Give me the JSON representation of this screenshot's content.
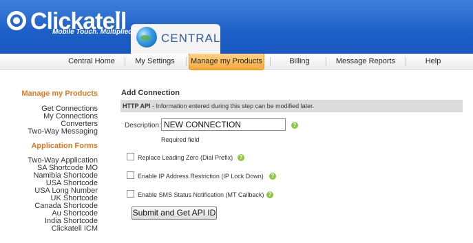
{
  "brand": {
    "logo_text": "Clickatell",
    "trademark": "™",
    "tagline": "Mobile Touch. Multiplied.",
    "central_label": "CENTRAL"
  },
  "nav": {
    "items": [
      {
        "label": "Central Home"
      },
      {
        "label": "My Settings"
      },
      {
        "label": "Manage my Products",
        "active": true
      },
      {
        "label": "Billing"
      },
      {
        "label": "Message Reports"
      },
      {
        "label": "Help"
      }
    ]
  },
  "sidebar": {
    "section1_title": "Manage my Products",
    "section1_links": [
      "Get Connections",
      "My Connections",
      "Converters",
      "Two-Way Messaging"
    ],
    "section2_title": "Application Forms",
    "section2_links": [
      "Two-Way Application",
      "SA Shortcode MO",
      "Namibia Shortcode",
      "USA Shortcode",
      "USA Long Number",
      "UK Shortcode",
      "Canada Shortcode",
      "Au Shortcode",
      "India Shortcode",
      "Clickatell ICM"
    ]
  },
  "form": {
    "title": "Add Connection",
    "api_bold": "HTTP API",
    "api_note": " - Information entered during this step can be modified later.",
    "description_label": "Description:",
    "description_value": "NEW CONNECTION",
    "required_text": "Required field",
    "options": [
      {
        "label": "Replace Leading Zero (Dial Prefix)",
        "checked": false
      },
      {
        "label": "Enable IP Address Restriction (IP Lock Down)",
        "checked": false
      },
      {
        "label": "Enable SMS Status Notification (MT Callback)",
        "checked": false
      }
    ],
    "submit_label": "Submit and Get API ID",
    "help_glyph": "?"
  },
  "colors": {
    "header_blue": "#1d5fc6",
    "sidebar_heading": "#e8751a",
    "active_tab": "#f5a83a",
    "help_green": "#8dc63f"
  }
}
